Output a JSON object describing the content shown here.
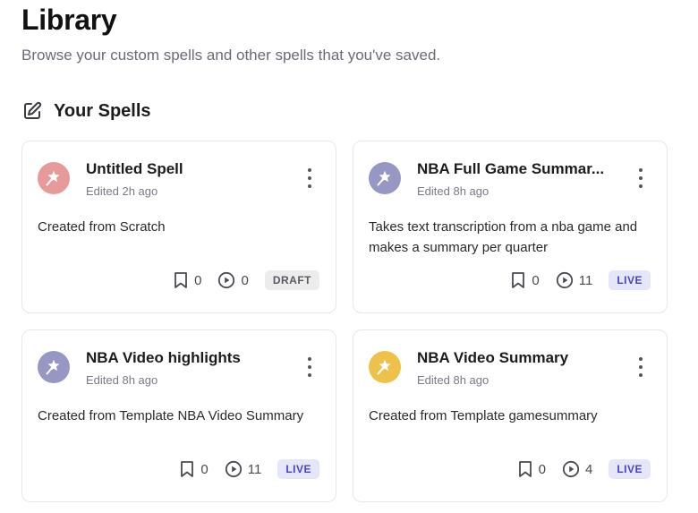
{
  "header": {
    "title": "Library",
    "subtitle": "Browse your custom spells and other spells that you've saved."
  },
  "section": {
    "title": "Your Spells",
    "icon": "edit-square-icon"
  },
  "colors": {
    "avatar_pink": "#e79a9a",
    "avatar_purple": "#9797c4",
    "avatar_yellow": "#eec24a",
    "live_badge_bg": "#e6e6fb",
    "live_badge_text": "#4b45b8",
    "draft_badge_bg": "#ececec"
  },
  "spells": [
    {
      "title": "Untitled Spell",
      "edited": "Edited 2h ago",
      "description": "Created from Scratch",
      "saves": "0",
      "runs": "0",
      "status": "DRAFT",
      "avatar_color": "#e79a9a"
    },
    {
      "title": "NBA Full Game Summar...",
      "edited": "Edited 8h ago",
      "description": "Takes text transcription from a nba game and makes a summary per quarter",
      "saves": "0",
      "runs": "11",
      "status": "LIVE",
      "avatar_color": "#9797c4"
    },
    {
      "title": "NBA Video highlights",
      "edited": "Edited 8h ago",
      "description": "Created from Template NBA Video Summary",
      "saves": "0",
      "runs": "11",
      "status": "LIVE",
      "avatar_color": "#9797c4"
    },
    {
      "title": "NBA Video Summary",
      "edited": "Edited 8h ago",
      "description": "Created from Template gamesummary",
      "saves": "0",
      "runs": "4",
      "status": "LIVE",
      "avatar_color": "#eec24a"
    }
  ]
}
